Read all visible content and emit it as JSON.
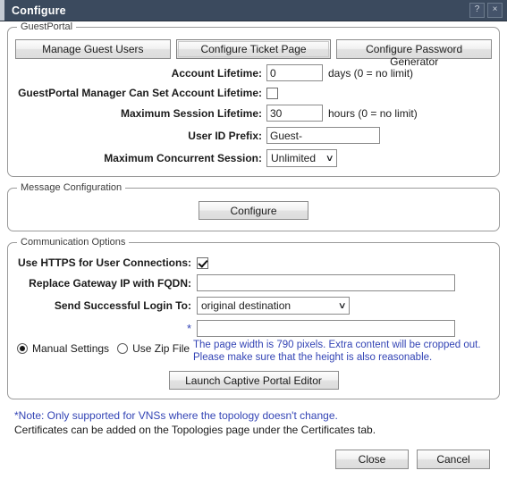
{
  "window": {
    "title": "Configure",
    "help_label": "?",
    "close_label": "×"
  },
  "guest_portal": {
    "legend": "GuestPortal",
    "buttons": [
      {
        "label": "Manage Guest Users"
      },
      {
        "label": "Configure Ticket Page"
      },
      {
        "label": "Configure Password Generator"
      }
    ],
    "account_lifetime": {
      "label": "Account Lifetime:",
      "value": "0",
      "suffix": "days (0 = no limit)"
    },
    "manager_can_set": {
      "label": "GuestPortal Manager Can Set Account Lifetime:",
      "checked": "false"
    },
    "max_session_lifetime": {
      "label": "Maximum Session Lifetime:",
      "value": "30",
      "suffix": "hours (0 = no limit)"
    },
    "user_id_prefix": {
      "label": "User ID Prefix:",
      "value": "Guest-"
    },
    "max_concurrent_session": {
      "label": "Maximum Concurrent Session:",
      "value": "Unlimited",
      "arrow": "∨"
    }
  },
  "message_configuration": {
    "legend": "Message Configuration",
    "configure_label": "Configure"
  },
  "communication_options": {
    "legend": "Communication Options",
    "use_https": {
      "label": "Use HTTPS for User Connections:",
      "checked": "true"
    },
    "replace_gateway_ip": {
      "label": "Replace Gateway IP with FQDN:",
      "value": ""
    },
    "send_successful_login": {
      "label": "Send Successful Login To:",
      "value": "original destination",
      "arrow": "∨"
    },
    "required_field": {
      "marker": "*",
      "value": ""
    },
    "radios": [
      {
        "label": "Manual Settings",
        "selected": "true"
      },
      {
        "label": "Use Zip File",
        "selected": "false"
      }
    ],
    "hint_line1": "The page width is 790 pixels. Extra content will be cropped out.",
    "hint_line2": "Please make sure that the height is also reasonable.",
    "launch_label": "Launch Captive Portal Editor"
  },
  "notes": {
    "line1": "*Note: Only supported for VNSs where the topology doesn't change.",
    "line2": "Certificates can be added on the Topologies page under the Certificates tab."
  },
  "footer": {
    "close_label": "Close",
    "cancel_label": "Cancel"
  },
  "colors": {
    "titlebar": "#3b4a5e",
    "accent_blue": "#3344b5",
    "border": "#9a9a9a"
  }
}
